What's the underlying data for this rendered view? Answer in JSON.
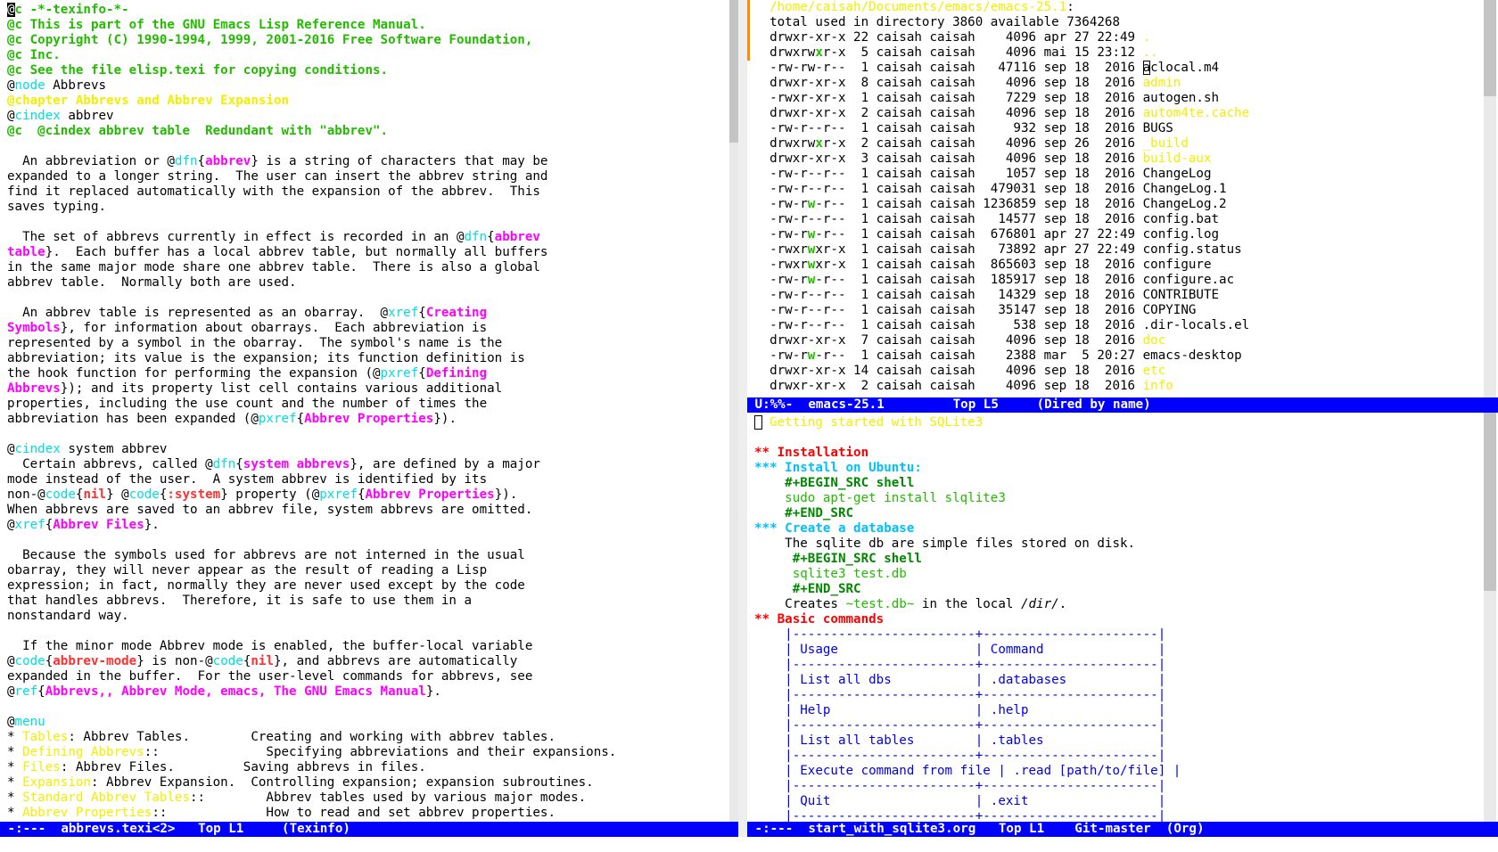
{
  "left": {
    "lines": [
      [
        [
          "@",
          "f-cursor"
        ],
        [
          "c -*-texinfo-*-",
          "f-comment"
        ]
      ],
      [
        [
          "@c This is part of the GNU Emacs Lisp Reference Manual.",
          "f-comment"
        ]
      ],
      [
        [
          "@c Copyright (C) 1990-1994, 1999, 2001-2016 Free Software Foundation,",
          "f-comment"
        ]
      ],
      [
        [
          "@c Inc.",
          "f-comment"
        ]
      ],
      [
        [
          "@c See the file elisp.texi for copying conditions.",
          "f-comment"
        ]
      ],
      [
        [
          "@",
          "f-plain"
        ],
        [
          "node",
          "f-kw"
        ],
        [
          " Abbrevs",
          "f-plain"
        ]
      ],
      [
        [
          "@chapter Abbrevs and Abbrev Expansion",
          "f-chap"
        ]
      ],
      [
        [
          "@",
          "f-plain"
        ],
        [
          "cindex",
          "f-kw"
        ],
        [
          " abbrev",
          "f-plain"
        ]
      ],
      [
        [
          "@c  @cindex abbrev table  Redundant with \"abbrev\".",
          "f-comment"
        ]
      ],
      [
        [
          "",
          "f-plain"
        ]
      ],
      [
        [
          "  An abbreviation or @",
          "f-plain"
        ],
        [
          "dfn",
          "f-kw"
        ],
        [
          "{",
          "f-plain"
        ],
        [
          "abbrev",
          "f-arg"
        ],
        [
          "} is a string of characters that may be",
          "f-plain"
        ]
      ],
      [
        [
          "expanded to a longer string.  The user can insert the abbrev string and",
          "f-plain"
        ]
      ],
      [
        [
          "find it replaced automatically with the expansion of the abbrev.  This",
          "f-plain"
        ]
      ],
      [
        [
          "saves typing.",
          "f-plain"
        ]
      ],
      [
        [
          "",
          "f-plain"
        ]
      ],
      [
        [
          "  The set of abbrevs currently in effect is recorded in an @",
          "f-plain"
        ],
        [
          "dfn",
          "f-kw"
        ],
        [
          "{",
          "f-plain"
        ],
        [
          "abbrev",
          "f-arg"
        ]
      ],
      [
        [
          "table",
          "f-arg"
        ],
        [
          "}.  Each buffer has a local abbrev table, but normally all buffers",
          "f-plain"
        ]
      ],
      [
        [
          "in the same major mode share one abbrev table.  There is also a global",
          "f-plain"
        ]
      ],
      [
        [
          "abbrev table.  Normally both are used.",
          "f-plain"
        ]
      ],
      [
        [
          "",
          "f-plain"
        ]
      ],
      [
        [
          "  An abbrev table is represented as an obarray.  @",
          "f-plain"
        ],
        [
          "xref",
          "f-kw"
        ],
        [
          "{",
          "f-plain"
        ],
        [
          "Creating",
          "f-arg"
        ]
      ],
      [
        [
          "Symbols",
          "f-arg"
        ],
        [
          "}, for information about obarrays.  Each abbreviation is",
          "f-plain"
        ]
      ],
      [
        [
          "represented by a symbol in the obarray.  The symbol's name is the",
          "f-plain"
        ]
      ],
      [
        [
          "abbreviation; its value is the expansion; its function definition is",
          "f-plain"
        ]
      ],
      [
        [
          "the hook function for performing the expansion (@",
          "f-plain"
        ],
        [
          "pxref",
          "f-kw"
        ],
        [
          "{",
          "f-plain"
        ],
        [
          "Defining",
          "f-arg"
        ]
      ],
      [
        [
          "Abbrevs",
          "f-arg"
        ],
        [
          "}); and its property list cell contains various additional",
          "f-plain"
        ]
      ],
      [
        [
          "properties, including the use count and the number of times the",
          "f-plain"
        ]
      ],
      [
        [
          "abbreviation has been expanded (@",
          "f-plain"
        ],
        [
          "pxref",
          "f-kw"
        ],
        [
          "{",
          "f-plain"
        ],
        [
          "Abbrev Properties",
          "f-arg"
        ],
        [
          "}).",
          "f-plain"
        ]
      ],
      [
        [
          "",
          "f-plain"
        ]
      ],
      [
        [
          "@",
          "f-plain"
        ],
        [
          "cindex",
          "f-kw"
        ],
        [
          " system abbrev",
          "f-plain"
        ]
      ],
      [
        [
          "  Certain abbrevs, called @",
          "f-plain"
        ],
        [
          "dfn",
          "f-kw"
        ],
        [
          "{",
          "f-plain"
        ],
        [
          "system abbrevs",
          "f-arg"
        ],
        [
          "}, are defined by a major",
          "f-plain"
        ]
      ],
      [
        [
          "mode instead of the user.  A system abbrev is identified by its",
          "f-plain"
        ]
      ],
      [
        [
          "non-@",
          "f-plain"
        ],
        [
          "code",
          "f-kw"
        ],
        [
          "{",
          "f-plain"
        ],
        [
          "nil",
          "f-name"
        ],
        [
          "} @",
          "f-plain"
        ],
        [
          "code",
          "f-kw"
        ],
        [
          "{",
          "f-plain"
        ],
        [
          ":system",
          "f-name"
        ],
        [
          "} property (@",
          "f-plain"
        ],
        [
          "pxref",
          "f-kw"
        ],
        [
          "{",
          "f-plain"
        ],
        [
          "Abbrev Properties",
          "f-arg"
        ],
        [
          "}).",
          "f-plain"
        ]
      ],
      [
        [
          "When abbrevs are saved to an abbrev file, system abbrevs are omitted.",
          "f-plain"
        ]
      ],
      [
        [
          "@",
          "f-plain"
        ],
        [
          "xref",
          "f-kw"
        ],
        [
          "{",
          "f-plain"
        ],
        [
          "Abbrev Files",
          "f-arg"
        ],
        [
          "}.",
          "f-plain"
        ]
      ],
      [
        [
          "",
          "f-plain"
        ]
      ],
      [
        [
          "  Because the symbols used for abbrevs are not interned in the usual",
          "f-plain"
        ]
      ],
      [
        [
          "obarray, they will never appear as the result of reading a Lisp",
          "f-plain"
        ]
      ],
      [
        [
          "expression; in fact, normally they are never used except by the code",
          "f-plain"
        ]
      ],
      [
        [
          "that handles abbrevs.  Therefore, it is safe to use them in a",
          "f-plain"
        ]
      ],
      [
        [
          "nonstandard way.",
          "f-plain"
        ]
      ],
      [
        [
          "",
          "f-plain"
        ]
      ],
      [
        [
          "  If the minor mode Abbrev mode is enabled, the buffer-local variable",
          "f-plain"
        ]
      ],
      [
        [
          "@",
          "f-plain"
        ],
        [
          "code",
          "f-kw"
        ],
        [
          "{",
          "f-plain"
        ],
        [
          "abbrev-mode",
          "f-name"
        ],
        [
          "} is non-@",
          "f-plain"
        ],
        [
          "code",
          "f-kw"
        ],
        [
          "{",
          "f-plain"
        ],
        [
          "nil",
          "f-name"
        ],
        [
          "}, and abbrevs are automatically",
          "f-plain"
        ]
      ],
      [
        [
          "expanded in the buffer.  For the user-level commands for abbrevs, see",
          "f-plain"
        ]
      ],
      [
        [
          "@",
          "f-plain"
        ],
        [
          "ref",
          "f-kw"
        ],
        [
          "{",
          "f-plain"
        ],
        [
          "Abbrevs,, Abbrev Mode, emacs, The GNU Emacs Manual",
          "f-arg"
        ],
        [
          "}.",
          "f-plain"
        ]
      ],
      [
        [
          "",
          "f-plain"
        ]
      ],
      [
        [
          "@",
          "f-plain"
        ],
        [
          "menu",
          "f-kw"
        ]
      ],
      [
        [
          "* ",
          "f-plain"
        ],
        [
          "Tables",
          "f-menu"
        ],
        [
          ": Abbrev Tables.        Creating and working with abbrev tables.",
          "f-plain"
        ]
      ],
      [
        [
          "* ",
          "f-plain"
        ],
        [
          "Defining Abbrevs",
          "f-menu"
        ],
        [
          "::              Specifying abbreviations and their expansions.",
          "f-plain"
        ]
      ],
      [
        [
          "* ",
          "f-plain"
        ],
        [
          "Files",
          "f-menu"
        ],
        [
          ": Abbrev Files.         Saving abbrevs in files.",
          "f-plain"
        ]
      ],
      [
        [
          "* ",
          "f-plain"
        ],
        [
          "Expansion",
          "f-menu"
        ],
        [
          ": Abbrev Expansion.  Controlling expansion; expansion subroutines.",
          "f-plain"
        ]
      ],
      [
        [
          "* ",
          "f-plain"
        ],
        [
          "Standard Abbrev Tables",
          "f-menu"
        ],
        [
          "::        Abbrev tables used by various major modes.",
          "f-plain"
        ]
      ],
      [
        [
          "* ",
          "f-plain"
        ],
        [
          "Abbrev Properties",
          "f-menu"
        ],
        [
          "::             How to read and set abbrev properties.",
          "f-plain"
        ]
      ]
    ],
    "modeline": " -:---  abbrevs.texi<2>   Top L1     (Texinfo)"
  },
  "topright": {
    "lines": [
      [
        [
          "  /home/caisah/Documents/emacs/emacs-25.1",
          "f-path"
        ],
        [
          ":",
          "f-plain"
        ]
      ],
      [
        [
          "  total used in directory 3860 available 7364268",
          "f-plain"
        ]
      ],
      [
        [
          "  drwxr-xr-x 22 caisah caisah    4096 apr 27 22:49 ",
          "f-plain"
        ],
        [
          ".",
          "f-dir"
        ]
      ],
      [
        [
          "  drwxrw",
          "f-plain"
        ],
        [
          "x",
          "f-wbit"
        ],
        [
          "r-x  5 caisah caisah    4096 mai 15 23:12 ",
          "f-plain"
        ],
        [
          "..",
          "f-dir"
        ]
      ],
      [
        [
          "  -rw-rw-r--  1 caisah caisah   47116 sep 18  2016 ",
          "f-plain"
        ],
        [
          "a",
          "cur-box"
        ],
        [
          "clocal.m4",
          "f-plain"
        ]
      ],
      [
        [
          "  drwxr-xr-x  8 caisah caisah    4096 sep 18  2016 ",
          "f-plain"
        ],
        [
          "admin",
          "f-dir"
        ]
      ],
      [
        [
          "  -rwxr-xr-x  1 caisah caisah    7229 sep 18  2016 autogen.sh",
          "f-plain"
        ]
      ],
      [
        [
          "  drwxr-xr-x  2 caisah caisah    4096 sep 18  2016 ",
          "f-plain"
        ],
        [
          "autom4te.cache",
          "f-dir"
        ]
      ],
      [
        [
          "  -rw-r--r--  1 caisah caisah     932 sep 18  2016 BUGS",
          "f-plain"
        ]
      ],
      [
        [
          "  drwxrw",
          "f-plain"
        ],
        [
          "x",
          "f-wbit"
        ],
        [
          "r-x  2 caisah caisah    4096 sep 26  2016 ",
          "f-plain"
        ],
        [
          "_build",
          "f-dir"
        ]
      ],
      [
        [
          "  drwxr-xr-x  3 caisah caisah    4096 sep 18  2016 ",
          "f-plain"
        ],
        [
          "build-aux",
          "f-dir"
        ]
      ],
      [
        [
          "  -rw-r--r--  1 caisah caisah    1057 sep 18  2016 ChangeLog",
          "f-plain"
        ]
      ],
      [
        [
          "  -rw-r--r--  1 caisah caisah  479031 sep 18  2016 ChangeLog.1",
          "f-plain"
        ]
      ],
      [
        [
          "  -rw-r",
          "f-plain"
        ],
        [
          "w",
          "f-wbit"
        ],
        [
          "-r--  1 caisah caisah 1236859 sep 18  2016 ChangeLog.2",
          "f-plain"
        ]
      ],
      [
        [
          "  -rw-r--r--  1 caisah caisah   14577 sep 18  2016 config.bat",
          "f-plain"
        ]
      ],
      [
        [
          "  -rw-r",
          "f-plain"
        ],
        [
          "w",
          "f-wbit"
        ],
        [
          "-r--  1 caisah caisah  676801 apr 27 22:49 config.log",
          "f-plain"
        ]
      ],
      [
        [
          "  -rwxr",
          "f-plain"
        ],
        [
          "w",
          "f-wbit"
        ],
        [
          "xr-x  1 caisah caisah   73892 apr 27 22:49 config.status",
          "f-plain"
        ]
      ],
      [
        [
          "  -rwxr",
          "f-plain"
        ],
        [
          "w",
          "f-wbit"
        ],
        [
          "xr-x  1 caisah caisah  865603 sep 18  2016 configure",
          "f-plain"
        ]
      ],
      [
        [
          "  -rw-r",
          "f-plain"
        ],
        [
          "w",
          "f-wbit"
        ],
        [
          "-r--  1 caisah caisah  185917 sep 18  2016 configure.ac",
          "f-plain"
        ]
      ],
      [
        [
          "  -rw-r--r--  1 caisah caisah   14329 sep 18  2016 CONTRIBUTE",
          "f-plain"
        ]
      ],
      [
        [
          "  -rw-r--r--  1 caisah caisah   35147 sep 18  2016 COPYING",
          "f-plain"
        ]
      ],
      [
        [
          "  -rw-r--r--  1 caisah caisah     538 sep 18  2016 .dir-locals.el",
          "f-plain"
        ]
      ],
      [
        [
          "  drwxr-xr-x  7 caisah caisah    4096 sep 18  2016 ",
          "f-plain"
        ],
        [
          "doc",
          "f-dir"
        ]
      ],
      [
        [
          "  -rw-r",
          "f-plain"
        ],
        [
          "w",
          "f-wbit"
        ],
        [
          "-r--  1 caisah caisah    2388 mar  5 20:27 emacs-desktop",
          "f-plain"
        ]
      ],
      [
        [
          "  drwxr-xr-x 14 caisah caisah    4096 sep 18  2016 ",
          "f-plain"
        ],
        [
          "etc",
          "f-dir"
        ]
      ],
      [
        [
          "  drwxr-xr-x  2 caisah caisah    4096 sep 18  2016 ",
          "f-plain"
        ],
        [
          "info",
          "f-dir"
        ]
      ]
    ],
    "modeline": " U:%%-  emacs-25.1         Top L5     (Dired by name)"
  },
  "bottomright": {
    "lines": [
      [
        [
          " ",
          "cur-box"
        ],
        [
          " Getting started with SQLite3",
          "f-title"
        ]
      ],
      [
        [
          "",
          "f-plain"
        ]
      ],
      [
        [
          "** ",
          "f-h2"
        ],
        [
          "Installation",
          "f-h2"
        ]
      ],
      [
        [
          "*** Install on Ubuntu:",
          "f-h3"
        ]
      ],
      [
        [
          "    #+BEGIN_SRC shell",
          "f-meta"
        ]
      ],
      [
        [
          "    sudo apt-get install slqlite3",
          "f-src"
        ]
      ],
      [
        [
          "    #+END_SRC",
          "f-meta"
        ]
      ],
      [
        [
          "*** Create a database",
          "f-h3"
        ]
      ],
      [
        [
          "    The sqlite db are simple files stored on disk.",
          "f-plain"
        ]
      ],
      [
        [
          "     #+BEGIN_SRC shell",
          "f-meta"
        ]
      ],
      [
        [
          "     sqlite3 test.db",
          "f-src"
        ]
      ],
      [
        [
          "     #+END_SRC",
          "f-meta"
        ]
      ],
      [
        [
          "    Creates ",
          "f-plain"
        ],
        [
          "~test.db~",
          "f-code"
        ],
        [
          " in the local ",
          "f-plain"
        ],
        [
          "/dir/",
          "f-ital"
        ],
        [
          ".",
          "f-plain"
        ]
      ],
      [
        [
          "** ",
          "f-h2"
        ],
        [
          "Basic commands",
          "f-h2"
        ]
      ],
      [
        [
          "    |------------------------+-----------------------|",
          "f-table"
        ]
      ],
      [
        [
          "    | Usage                  | Command               |",
          "f-table"
        ]
      ],
      [
        [
          "    |------------------------+-----------------------|",
          "f-table"
        ]
      ],
      [
        [
          "    | List all dbs           | .databases            |",
          "f-table"
        ]
      ],
      [
        [
          "    |------------------------+-----------------------|",
          "f-table"
        ]
      ],
      [
        [
          "    | Help                   | .help                 |",
          "f-table"
        ]
      ],
      [
        [
          "    |------------------------+-----------------------|",
          "f-table"
        ]
      ],
      [
        [
          "    | List all tables        | .tables               |",
          "f-table"
        ]
      ],
      [
        [
          "    |------------------------+-----------------------|",
          "f-table"
        ]
      ],
      [
        [
          "    | Execute command from file | .read [path/to/file] |",
          "f-table"
        ]
      ],
      [
        [
          "    |------------------------+-----------------------|",
          "f-table"
        ]
      ],
      [
        [
          "    | Quit                   | .exit                 |",
          "f-table"
        ]
      ],
      [
        [
          "    |------------------------+-----------------------|",
          "f-table"
        ]
      ]
    ],
    "modeline": " -:---  start_with_sqlite3.org   Top L1    Git-master  (Org)"
  }
}
